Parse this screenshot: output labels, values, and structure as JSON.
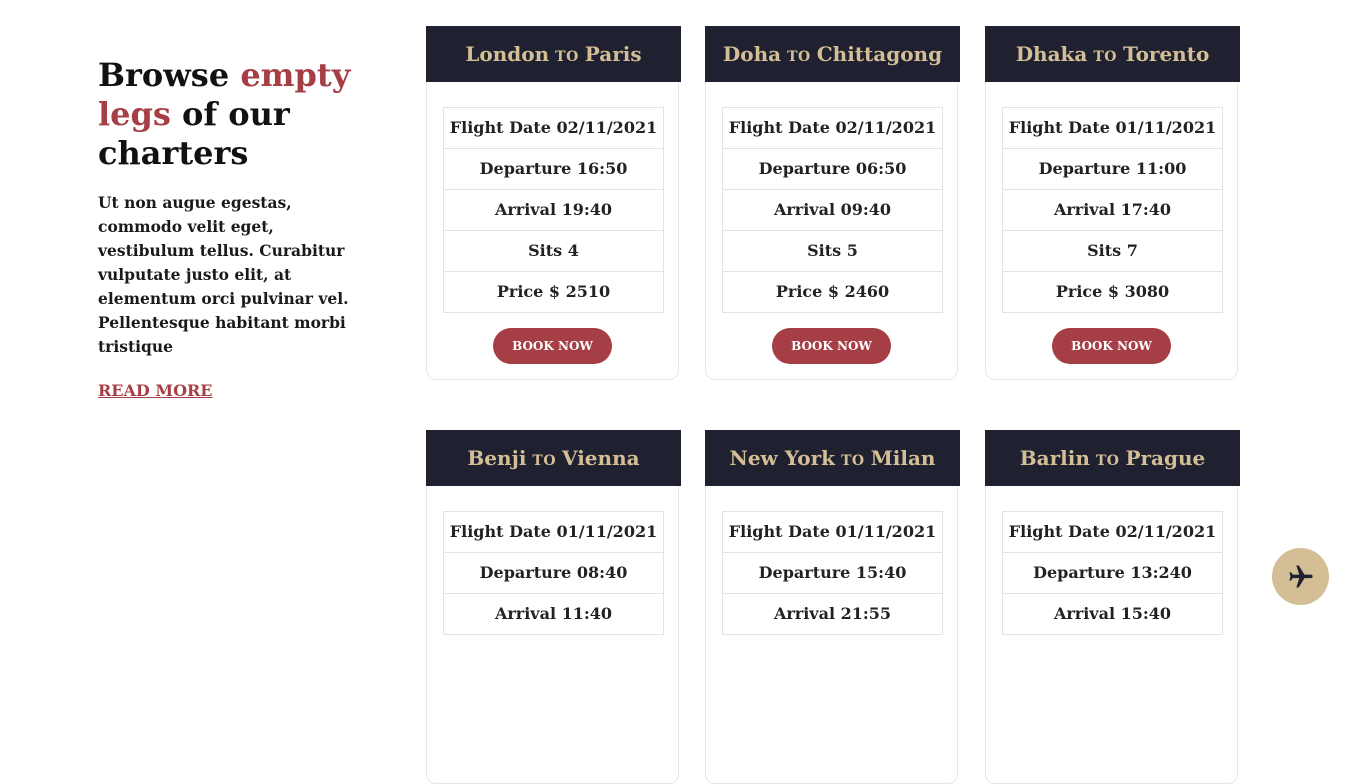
{
  "intro": {
    "title_part1": "Browse ",
    "title_accent": "empty legs",
    "title_part2": " of our charters",
    "description": "Ut non augue egestas, commodo velit eget, vestibulum tellus. Curabitur vulputate justo elit, at elementum orci pulvinar vel. Pellentesque habitant morbi tristique",
    "read_more": "READ MORE"
  },
  "colors": {
    "accent": "#a63e45",
    "header_bg": "#1f2130",
    "header_text": "#d4be96",
    "fab_bg": "#d4be96"
  },
  "cards": [
    {
      "from": "London",
      "to_word": "TO",
      "to": "Paris",
      "flight_date": "Flight Date 02/11/2021",
      "departure": "Departure 16:50",
      "arrival": "Arrival 19:40",
      "sits": "Sits 4",
      "price": "Price $ 2510",
      "button": "BOOK NOW"
    },
    {
      "from": "Doha",
      "to_word": "TO",
      "to": "Chittagong",
      "flight_date": "Flight Date 02/11/2021",
      "departure": "Departure 06:50",
      "arrival": "Arrival 09:40",
      "sits": "Sits 5",
      "price": "Price $ 2460",
      "button": "BOOK NOW"
    },
    {
      "from": "Dhaka",
      "to_word": "TO",
      "to": "Torento",
      "flight_date": "Flight Date 01/11/2021",
      "departure": "Departure 11:00",
      "arrival": "Arrival 17:40",
      "sits": "Sits 7",
      "price": "Price $ 3080",
      "button": "BOOK NOW"
    },
    {
      "from": "Benji",
      "to_word": "TO",
      "to": "Vienna",
      "flight_date": "Flight Date 01/11/2021",
      "departure": "Departure 08:40",
      "arrival": "Arrival 11:40"
    },
    {
      "from": "New York",
      "to_word": "TO",
      "to": "Milan",
      "flight_date": "Flight Date 01/11/2021",
      "departure": "Departure 15:40",
      "arrival": "Arrival 21:55"
    },
    {
      "from": "Barlin",
      "to_word": "TO",
      "to": "Prague",
      "flight_date": "Flight Date 02/11/2021",
      "departure": "Departure 13:240",
      "arrival": "Arrival 15:40"
    }
  ],
  "fab": {
    "icon": "airplane-icon"
  }
}
